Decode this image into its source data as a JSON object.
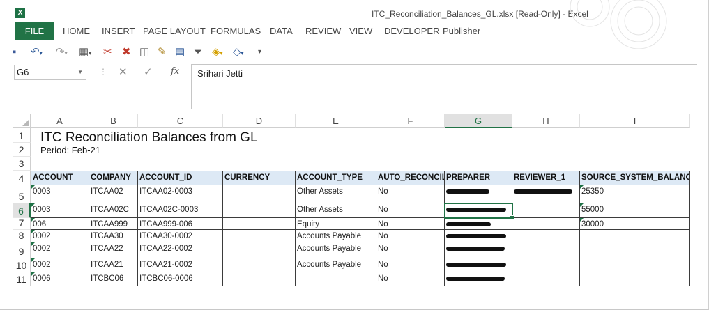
{
  "window": {
    "title": "ITC_Reconciliation_Balances_GL.xlsx  [Read-Only] - Excel",
    "logo_letter": "X"
  },
  "ribbon": {
    "tabs": [
      {
        "label": "FILE"
      },
      {
        "label": "HOME"
      },
      {
        "label": "INSERT"
      },
      {
        "label": "PAGE LAYOUT"
      },
      {
        "label": "FORMULAS"
      },
      {
        "label": "DATA"
      },
      {
        "label": "REVIEW"
      },
      {
        "label": "VIEW"
      },
      {
        "label": "DEVELOPER"
      },
      {
        "label": "Publisher"
      }
    ]
  },
  "quick_access": {
    "icons": [
      "save-icon",
      "undo-icon",
      "redo-icon",
      "format-icon",
      "delete-columns-icon",
      "cut-icon",
      "camera-icon",
      "format-painter-icon",
      "table-icon",
      "filter-icon",
      "fill-color-icon",
      "shapes-icon",
      "customize-icon"
    ]
  },
  "formula_bar": {
    "name_box": "G6",
    "cancel_symbol": "✕",
    "enter_symbol": "✓",
    "fx_label": "fx",
    "content": "Srihari Jetti"
  },
  "sheet": {
    "columns": [
      "A",
      "B",
      "C",
      "D",
      "E",
      "F",
      "G",
      "H",
      "I"
    ],
    "selected_column": "G",
    "selected_row": "6",
    "rows": [
      "1",
      "2",
      "3",
      "4",
      "5",
      "6",
      "7",
      "8",
      "9",
      "10",
      "11"
    ],
    "title": "ITC Reconciliation Balances from GL",
    "period": "Period: Feb-21",
    "headers": [
      "ACCOUNT",
      "COMPANY",
      "ACCOUNT_ID",
      "CURRENCY",
      "ACCOUNT_TYPE",
      "AUTO_RECONCIL",
      "PREPARER",
      "REVIEWER_1",
      "SOURCE_SYSTEM_BALANCE"
    ],
    "data": [
      [
        "0003",
        "ITCAA02",
        "ITCAA02-0003",
        "",
        "Other Assets",
        "No",
        "",
        "",
        "25350"
      ],
      [
        "0003",
        "ITCAA02C",
        "ITCAA02C-0003",
        "",
        "Other Assets",
        "No",
        "",
        "",
        "55000"
      ],
      [
        "006",
        "ITCAA999",
        "ITCAA999-006",
        "",
        "Equity",
        "No",
        "",
        "",
        "30000"
      ],
      [
        "0002",
        "ITCAA30",
        "ITCAA30-0002",
        "",
        "Accounts Payable",
        "No",
        "",
        "",
        ""
      ],
      [
        "0002",
        "ITCAA22",
        "ITCAA22-0002",
        "",
        "Accounts Payable",
        "No",
        "",
        "",
        ""
      ],
      [
        "0002",
        "ITCAA21",
        "ITCAA21-0002",
        "",
        "Accounts Payable",
        "No",
        "",
        "",
        ""
      ],
      [
        "0006",
        "ITCBC06",
        "ITCBC06-0006",
        "",
        "",
        "No",
        "",
        "",
        ""
      ]
    ],
    "colors": {
      "accent": "#217346",
      "header_fill": "#dde9f5"
    }
  }
}
